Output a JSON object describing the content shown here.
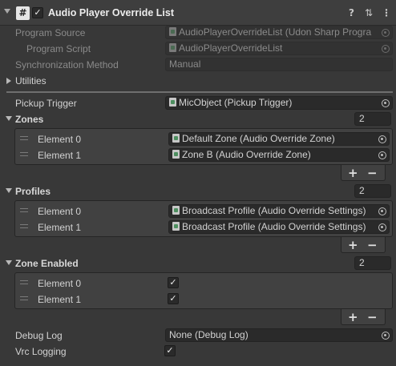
{
  "header": {
    "title": "Audio Player Override List",
    "script_icon_glyph": "#",
    "enabled_mark": "✓",
    "help_icon": "?",
    "presets_icon": "⇅",
    "menu_icon": "⋮"
  },
  "script_info": {
    "program_source_label": "Program Source",
    "program_source_value": "AudioPlayerOverrideList (Udon Sharp Progra",
    "program_script_label": "Program Script",
    "program_script_value": "AudioPlayerOverrideList",
    "sync_label": "Synchronization Method",
    "sync_value": "Manual",
    "utilities_label": "Utilities"
  },
  "pickup": {
    "label": "Pickup Trigger",
    "value": "MicObject (Pickup Trigger)"
  },
  "zones": {
    "label": "Zones",
    "count": "2",
    "items": [
      {
        "label": "Element 0",
        "value": "Default Zone (Audio Override Zone)"
      },
      {
        "label": "Element 1",
        "value": "Zone B (Audio Override Zone)"
      }
    ]
  },
  "profiles": {
    "label": "Profiles",
    "count": "2",
    "items": [
      {
        "label": "Element 0",
        "value": "Broadcast Profile (Audio Override Settings)"
      },
      {
        "label": "Element 1",
        "value": "Broadcast Profile (Audio Override Settings)"
      }
    ]
  },
  "zone_enabled": {
    "label": "Zone Enabled",
    "count": "2",
    "items": [
      {
        "label": "Element 0",
        "mark": "✓"
      },
      {
        "label": "Element 1",
        "mark": "✓"
      }
    ]
  },
  "list_controls": {
    "plus": "+",
    "minus": "−"
  },
  "debug_log": {
    "label": "Debug Log",
    "value": "None (Debug Log)"
  },
  "vrc_logging": {
    "label": "Vrc Logging",
    "mark": "✓"
  },
  "colors": {
    "background": "#383838",
    "header": "#3e3e3e",
    "field": "#2a2a2a",
    "text": "#d2d2d2"
  }
}
